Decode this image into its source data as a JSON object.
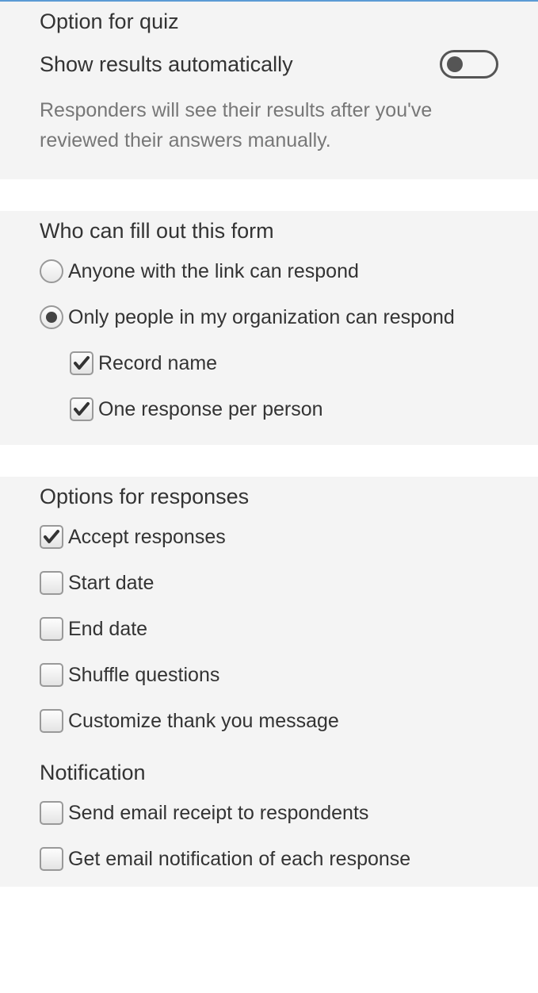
{
  "quiz": {
    "title": "Option for quiz",
    "show_results_label": "Show results automatically",
    "show_results_on": false,
    "description": "Responders will see their results after you've reviewed their answers manually."
  },
  "access": {
    "title": "Who can fill out this form",
    "anyone_label": "Anyone with the link can respond",
    "org_label": "Only people in my organization can respond",
    "selected": "org",
    "record_name_label": "Record name",
    "record_name_checked": true,
    "one_response_label": "One response per person",
    "one_response_checked": true
  },
  "responses": {
    "title": "Options for responses",
    "accept_label": "Accept responses",
    "accept_checked": true,
    "start_date_label": "Start date",
    "start_date_checked": false,
    "end_date_label": "End date",
    "end_date_checked": false,
    "shuffle_label": "Shuffle questions",
    "shuffle_checked": false,
    "customize_label": "Customize thank you message",
    "customize_checked": false
  },
  "notification": {
    "title": "Notification",
    "receipt_label": "Send email receipt to respondents",
    "receipt_checked": false,
    "email_label": "Get email notification of each response",
    "email_checked": false
  }
}
